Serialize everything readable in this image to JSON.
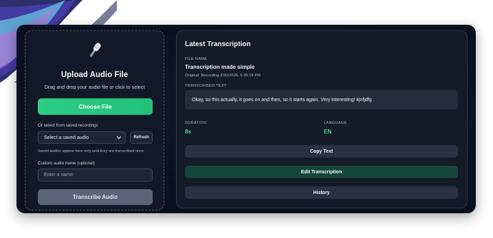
{
  "upload": {
    "title": "Upload Audio File",
    "subtitle": "Drag and drop your audio file or click to select",
    "choose_label": "Choose File",
    "saved_label": "Or select from saved recordings",
    "select_value": "Select a saved audio",
    "refresh_label": "Refresh",
    "saved_note": "Saved audios appear here only until they are transcribed once.",
    "name_label": "Custom audio name (optional)",
    "name_placeholder": "Enter a name",
    "transcribe_label": "Transcribe Audio"
  },
  "result": {
    "title": "Latest Transcription",
    "file_name_caption": "FILE NAME",
    "file_name": "Transcription made simple",
    "original": "Original: Recording 2/20/2026, 5:35:19 PM",
    "text_caption": "TRANSCRIBED TEXT",
    "text": "Okay, so this actually, it goes on and then, so it starts again. Very interesting! kjnfjdfg",
    "duration_caption": "DURATION",
    "duration": "8s",
    "language_caption": "LANGUAGE",
    "language": "EN",
    "copy_label": "Copy Text",
    "edit_label": "Edit Transcription",
    "history_label": "History"
  },
  "icons": {
    "upload": "microphone-icon",
    "select": "chevron-down-icon"
  },
  "colors": {
    "accent_green": "#2ecc82",
    "panel_bg": "#0b1020",
    "value_green": "#4ade80",
    "edit_bg": "#14463a"
  }
}
